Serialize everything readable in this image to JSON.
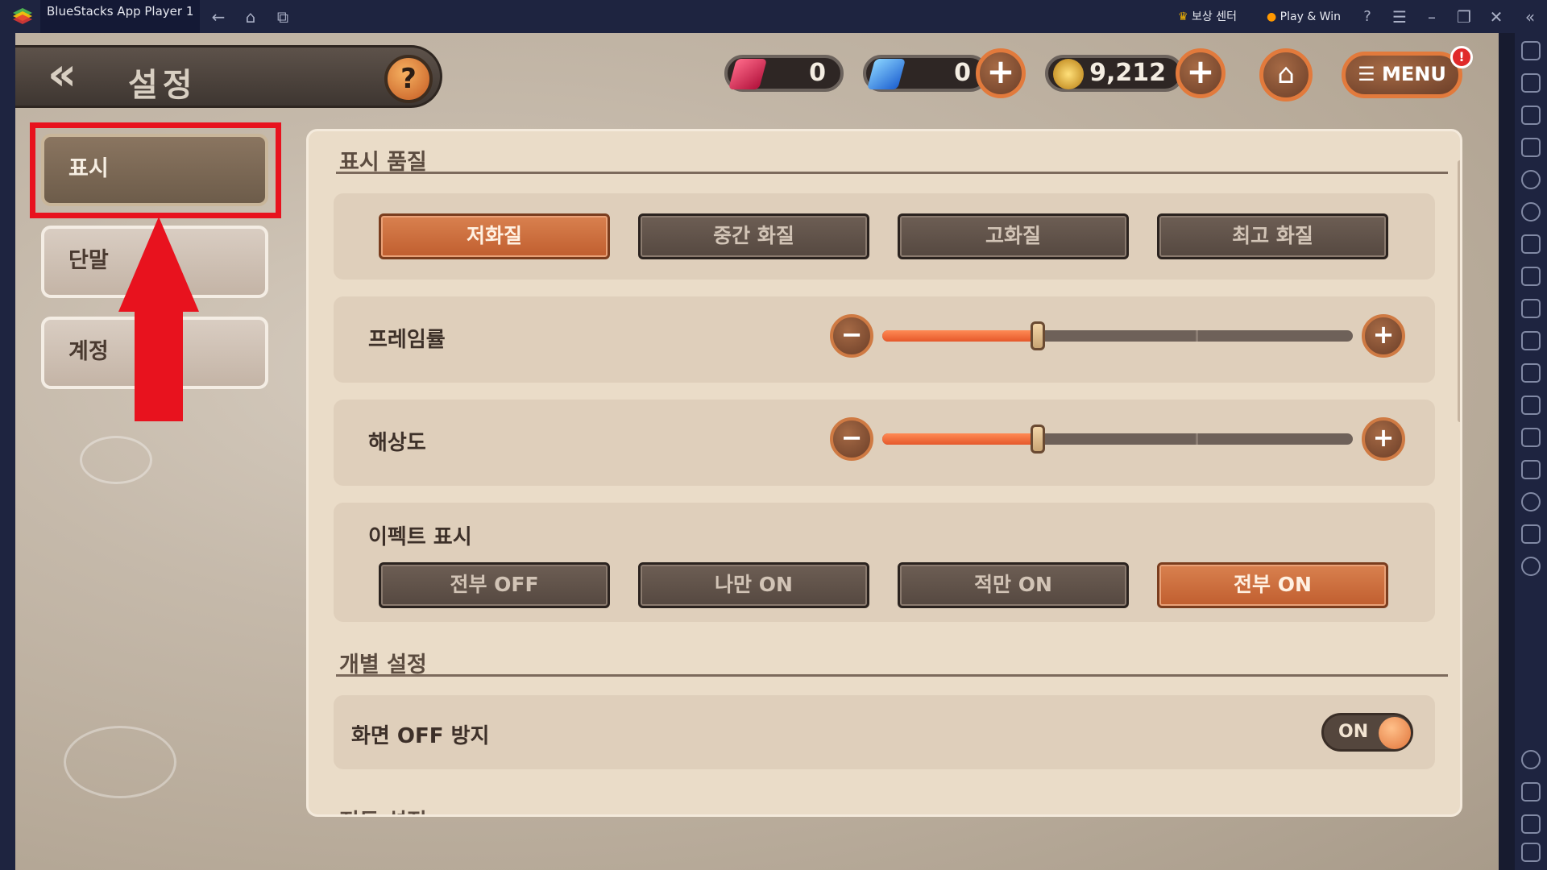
{
  "titlebar": {
    "app_title": "BlueStacks App Player 1",
    "reward_center": "보상 센터",
    "play_win": "Play & Win"
  },
  "header": {
    "title": "설정",
    "help_label": "?"
  },
  "currency": {
    "red_gem": "0",
    "blue_gem": "0",
    "gold": "9,212"
  },
  "menu": {
    "label": "☰ MENU",
    "badge": "!"
  },
  "left_menu": {
    "items": [
      {
        "label": "표시",
        "active": true
      },
      {
        "label": "단말",
        "active": false
      },
      {
        "label": "계정",
        "active": false
      }
    ]
  },
  "display_quality": {
    "section_title": "표시 품질",
    "options": [
      "저화질",
      "중간 화질",
      "고화질",
      "최고 화질"
    ],
    "selected": "저화질"
  },
  "framerate": {
    "label": "프레임률",
    "value_fraction": 0.33
  },
  "resolution": {
    "label": "해상도",
    "value_fraction": 0.33
  },
  "effects": {
    "label": "이펙트 표시",
    "options": [
      "전부 OFF",
      "나만 ON",
      "적만 ON",
      "전부 ON"
    ],
    "selected": "전부 ON"
  },
  "individual": {
    "section_title": "개별 설정",
    "screen_off_label": "화면 OFF 방지",
    "toggle_label": "ON"
  },
  "combat": {
    "section_title": "전투 설정"
  },
  "colors": {
    "accent_orange": "#c96a3a",
    "highlight_red": "#e8121e",
    "panel_bg": "#eadcc8"
  }
}
